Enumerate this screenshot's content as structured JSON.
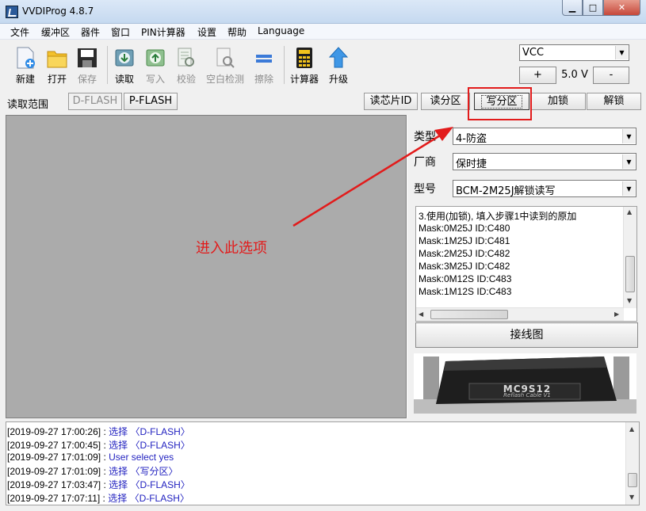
{
  "window": {
    "title": "VVDIProg 4.8.7",
    "controls": {
      "minimize": "▁",
      "maximize": "□",
      "close": "✕"
    }
  },
  "menu": [
    "文件",
    "缓冲区",
    "器件",
    "窗口",
    "PIN计算器",
    "设置",
    "帮助",
    "Language"
  ],
  "toolbar": {
    "new": "新建",
    "open": "打开",
    "save": "保存",
    "read": "读取",
    "write": "写入",
    "verify": "校验",
    "blank_check": "空白检测",
    "erase": "擦除",
    "calculator": "计算器",
    "upgrade": "升级"
  },
  "vcc": {
    "select_value": "VCC",
    "plus": "+",
    "voltage": "5.0 V",
    "minus": "-"
  },
  "range": {
    "label": "读取范围",
    "d_flash": "D-FLASH",
    "p_flash": "P-FLASH",
    "read_id": "读芯片ID",
    "read_partition": "读分区",
    "write_partition": "写分区",
    "lock": "加锁",
    "unlock": "解锁"
  },
  "panel": {
    "type_label": "类型",
    "type_value": "4-防盗",
    "vendor_label": "厂商",
    "vendor_value": "保时捷",
    "model_label": "型号",
    "model_value": "BCM-2M25J解锁读写"
  },
  "info_lines": [
    "3.使用(加锁), 填入步骤1中读到的原加",
    "Mask:0M25J ID:C480",
    "Mask:1M25J ID:C481",
    "Mask:2M25J ID:C482",
    "Mask:3M25J ID:C482",
    "Mask:0M12S ID:C483",
    "Mask:1M12S ID:C483"
  ],
  "wiring_button": "接线图",
  "connector": {
    "label": "MC9S12",
    "sub_label": "Reflash Cable V1"
  },
  "log": [
    {
      "ts": "[2019-09-27 17:00:26]",
      "sep": " : ",
      "msg": "选择 〈D-FLASH〉"
    },
    {
      "ts": "[2019-09-27 17:00:45]",
      "sep": " : ",
      "msg": "选择 〈D-FLASH〉"
    },
    {
      "ts": "[2019-09-27 17:01:09]",
      "sep": " : ",
      "msg": "User select yes"
    },
    {
      "ts": "[2019-09-27 17:01:09]",
      "sep": " : ",
      "msg": "选择 〈写分区〉"
    },
    {
      "ts": "[2019-09-27 17:03:47]",
      "sep": " : ",
      "msg": "选择 〈D-FLASH〉"
    },
    {
      "ts": "[2019-09-27 17:07:11]",
      "sep": " : ",
      "msg": "选择 〈D-FLASH〉"
    }
  ],
  "annotation": {
    "text": "进入此选项",
    "color": "#e21b1b"
  },
  "icons": {
    "new": "new-file-icon",
    "open": "folder-icon",
    "save": "floppy-icon",
    "read": "chip-read-icon",
    "write": "chip-write-icon",
    "verify": "verify-icon",
    "blank_check": "blank-check-icon",
    "erase": "erase-icon",
    "calculator": "calculator-icon",
    "upgrade": "upgrade-arrow-icon"
  },
  "colors": {
    "work_area": "#ababab",
    "log_message": "#1f1fbf",
    "highlight": "#e21b1b"
  }
}
